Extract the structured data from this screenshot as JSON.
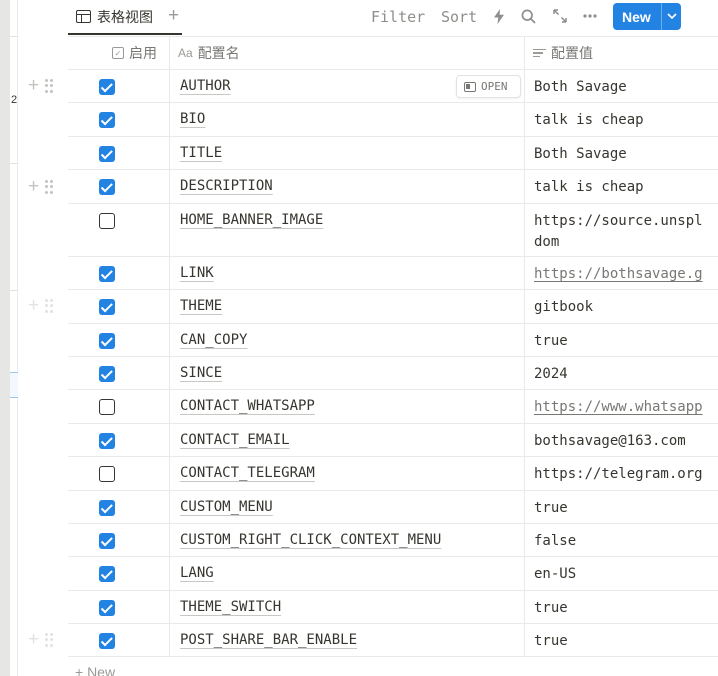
{
  "left_digit": "2",
  "toolbar": {
    "view_tab_label": "表格视图",
    "add_view_icon": "+",
    "filter_label": "Filter",
    "sort_label": "Sort",
    "automation_icon": "lightning-icon",
    "search_icon": "search-icon",
    "expand_icon": "diagonal-arrows-icon",
    "more_icon": "more-dots-icon",
    "new_label": "New",
    "new_chevron": "⌄"
  },
  "table": {
    "headers": {
      "enabled": "启用",
      "name": "配置名",
      "name_icon": "Aa",
      "value": "配置值"
    },
    "open_label": "OPEN",
    "rows": [
      {
        "enabled": true,
        "name": "AUTHOR",
        "value": "Both Savage"
      },
      {
        "enabled": true,
        "name": "BIO",
        "value": "talk is cheap"
      },
      {
        "enabled": true,
        "name": "TITLE",
        "value": "Both Savage"
      },
      {
        "enabled": true,
        "name": "DESCRIPTION",
        "value": "talk is cheap"
      },
      {
        "enabled": false,
        "name": "HOME_BANNER_IMAGE",
        "value": "https://source.unspl",
        "value_line2": "dom"
      },
      {
        "enabled": true,
        "name": "LINK",
        "value": "https://bothsavage.g"
      },
      {
        "enabled": true,
        "name": "THEME",
        "value": "gitbook"
      },
      {
        "enabled": true,
        "name": "CAN_COPY",
        "value": "true"
      },
      {
        "enabled": true,
        "name": "SINCE",
        "value": "2024"
      },
      {
        "enabled": false,
        "name": "CONTACT_WHATSAPP",
        "value": "https://www.whatsapp"
      },
      {
        "enabled": true,
        "name": "CONTACT_EMAIL",
        "value": "bothsavage@163.com"
      },
      {
        "enabled": false,
        "name": "CONTACT_TELEGRAM",
        "value": "https://telegram.org"
      },
      {
        "enabled": true,
        "name": "CUSTOM_MENU",
        "value": "true"
      },
      {
        "enabled": true,
        "name": "CUSTOM_RIGHT_CLICK_CONTEXT_MENU",
        "value": "false"
      },
      {
        "enabled": true,
        "name": "LANG",
        "value": "en-US"
      },
      {
        "enabled": true,
        "name": "THEME_SWITCH",
        "value": "true"
      },
      {
        "enabled": true,
        "name": "POST_SHARE_BAR_ENABLE",
        "value": "true"
      }
    ],
    "new_row_label": "+ New"
  }
}
